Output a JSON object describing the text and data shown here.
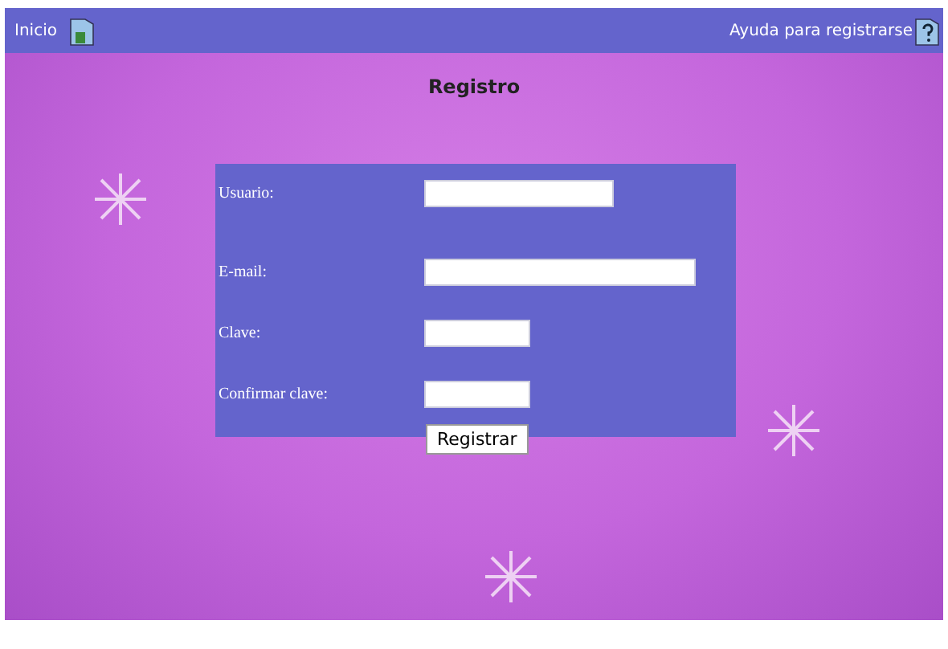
{
  "top_bar": {
    "home_link": "Inicio",
    "help_link": "Ayuda para registrarse"
  },
  "title": "Registro",
  "form": {
    "fields": [
      {
        "label": "Usuario:"
      },
      {
        "label": "E-mail:"
      },
      {
        "label": "Clave:"
      },
      {
        "label": "Confirmar clave:"
      }
    ],
    "submit": "Registrar"
  }
}
